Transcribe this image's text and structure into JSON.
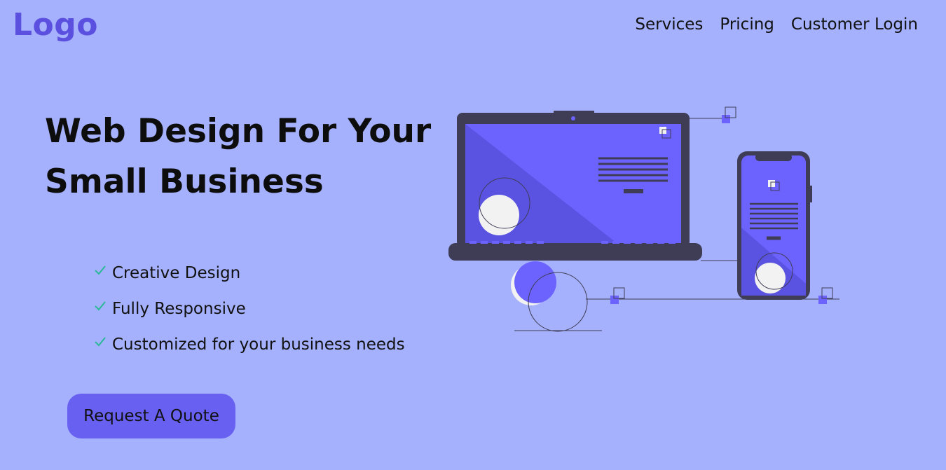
{
  "header": {
    "logo": "Logo",
    "nav": [
      {
        "label": "Services"
      },
      {
        "label": "Pricing"
      },
      {
        "label": "Customer Login"
      }
    ]
  },
  "hero": {
    "title_line1": "Web Design For Your",
    "title_line2": "Small Business",
    "features": [
      {
        "label": "Creative Design",
        "icon": "check-icon"
      },
      {
        "label": "Fully Responsive",
        "icon": "check-icon"
      },
      {
        "label": "Customized for your business needs",
        "icon": "check-icon"
      }
    ],
    "cta_label": "Request A Quote"
  },
  "colors": {
    "background": "#a5b1fc",
    "accent": "#6860f0",
    "logo": "#5b4fe0",
    "check": "#2bb89a",
    "device_frame": "#3f3d56"
  },
  "illustration": {
    "icon": "laptop-phone-illustration"
  }
}
